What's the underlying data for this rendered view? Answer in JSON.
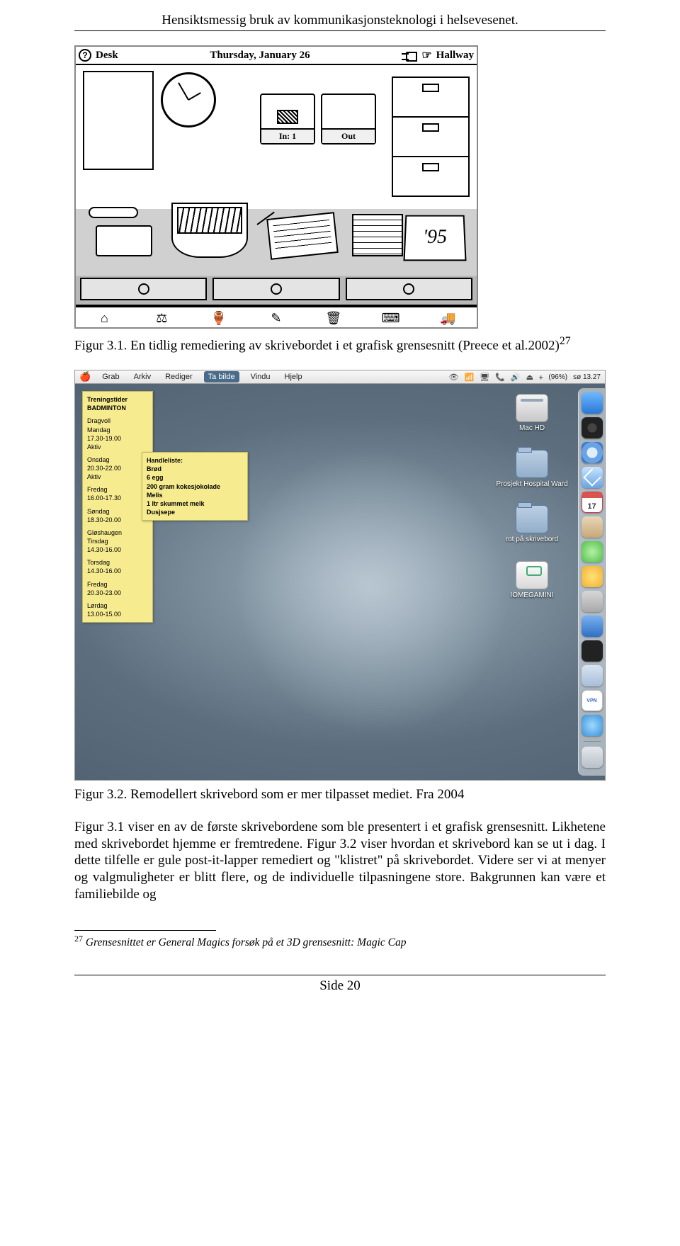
{
  "header": {
    "running_title": "Hensiktsmessig bruk av kommunikasjonsteknologi i helsevesenet."
  },
  "figure1": {
    "topbar": {
      "help_glyph": "?",
      "desk_label": "Desk",
      "date_text": "Thursday, January 26",
      "hallway_label": "Hallway"
    },
    "in_label": "In: 1",
    "out_label": "Out",
    "calendar_year": "'95",
    "bottom_icons": [
      "⌂",
      "⚖",
      "🏺",
      "✎",
      "🗑",
      "⌨",
      "🚚"
    ],
    "caption": "Figur 3.1. En tidlig remediering av skrivebordet i et grafisk grensesnitt (Preece et al.2002)",
    "caption_sup": "27"
  },
  "figure2": {
    "menubar": {
      "items": [
        "Grab",
        "Arkiv",
        "Rediger",
        "Ta bilde",
        "Vindu",
        "Hjelp"
      ],
      "active_index": 3,
      "right": {
        "icons": [
          "👁",
          "📶",
          "🖥",
          "📞",
          "🔊",
          "⏏",
          "ᚐ"
        ],
        "battery": "(96%)",
        "clock": "sø 13.27"
      }
    },
    "sticky1": {
      "title1": "Treningstider",
      "title2": "BADMINTON",
      "entries": [
        {
          "place": "Dragvoll",
          "day": "Mandag",
          "time": "17.30-19.00",
          "note": "Aktiv"
        },
        {
          "place": "",
          "day": "Onsdag",
          "time": "20.30-22.00",
          "note": "Aktiv"
        },
        {
          "place": "",
          "day": "Fredag",
          "time": "16.00-17.30",
          "note": ""
        },
        {
          "place": "",
          "day": "Søndag",
          "time": "18.30-20.00",
          "note": ""
        },
        {
          "place": "Gløshaugen",
          "day": "Tirsdag",
          "time": "14.30-16.00",
          "note": ""
        },
        {
          "place": "",
          "day": "Torsdag",
          "time": "14.30-16.00",
          "note": ""
        },
        {
          "place": "",
          "day": "Fredag",
          "time": "20.30-23.00",
          "note": ""
        },
        {
          "place": "",
          "day": "Lørdag",
          "time": "13.00-15.00",
          "note": ""
        }
      ]
    },
    "sticky2": {
      "title": "Handleliste:",
      "items": [
        "Brød",
        "6 egg",
        "200 gram kokesjokolade",
        "Melis",
        "1 ltr skummet melk",
        "Dusjsepe"
      ]
    },
    "desktop_icons": [
      {
        "label": "Mac HD",
        "kind": "hd"
      },
      {
        "label": "Prosjekt Hospital Ward",
        "kind": "fold"
      },
      {
        "label": "rot på skrivebord",
        "kind": "fold"
      },
      {
        "label": "IOMEGAMINI",
        "kind": "ext"
      }
    ],
    "vpn_label": "VPN",
    "caption_pre": "Figur 3.2. Remodellert skrivebord som er mer tilpasset mediet. Fra 2004"
  },
  "body_paragraph": "Figur 3.1 viser en av de første skrivebordene som ble presentert i et grafisk grensesnitt. Likhetene med skrivebordet hjemme er fremtredene. Figur 3.2 viser hvordan et skrivebord kan se ut i dag. I dette tilfelle er gule post-it-lapper remediert og \"klistret\" på skrivebordet. Videre ser vi at menyer og valgmuligheter er blitt flere, og de individuelle tilpasningene store. Bakgrunnen kan være et familiebilde og",
  "footnote": {
    "num": "27",
    "text": " Grensesnittet er General Magics forsøk på et 3D grensesnitt: Magic Cap"
  },
  "footer": {
    "page": "Side 20"
  }
}
